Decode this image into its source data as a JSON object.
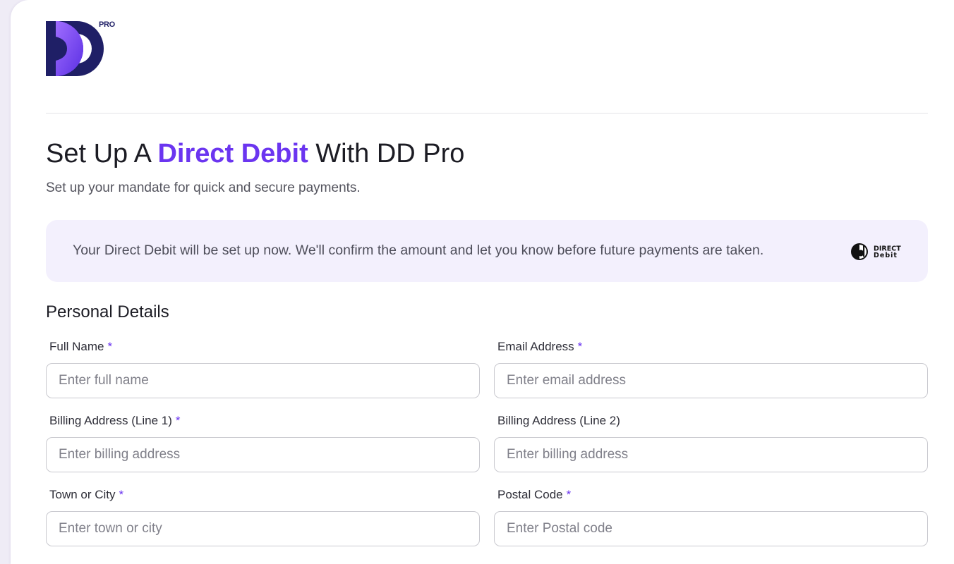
{
  "brand": {
    "logo_badge": "PRO"
  },
  "header": {
    "title_prefix": "Set Up A ",
    "title_accent": "Direct Debit",
    "title_suffix": " With DD Pro",
    "subtitle": "Set up your mandate for quick and secure payments."
  },
  "notice": {
    "text": "Your Direct Debit will be set up now. We'll confirm the amount and let you know before future payments are taken.",
    "badge_line1": "DIRECT",
    "badge_line2": "Debit"
  },
  "section": {
    "title": "Personal Details"
  },
  "required_marker": "*",
  "fields": {
    "full_name": {
      "label": "Full Name",
      "placeholder": "Enter full name",
      "value": ""
    },
    "email": {
      "label": "Email Address",
      "placeholder": "Enter email address",
      "value": ""
    },
    "billing1": {
      "label": "Billing Address (Line 1)",
      "placeholder": "Enter billing address",
      "value": ""
    },
    "billing2": {
      "label": "Billing Address (Line 2)",
      "placeholder": "Enter billing address",
      "value": ""
    },
    "town": {
      "label": "Town or City",
      "placeholder": "Enter town or city",
      "value": ""
    },
    "postal": {
      "label": "Postal Code",
      "placeholder": "Enter Postal code",
      "value": ""
    }
  },
  "colors": {
    "accent": "#6b35f0",
    "logo_dark": "#1f1f66",
    "notice_bg": "#f3f0fd",
    "page_bg": "#efecf6"
  }
}
